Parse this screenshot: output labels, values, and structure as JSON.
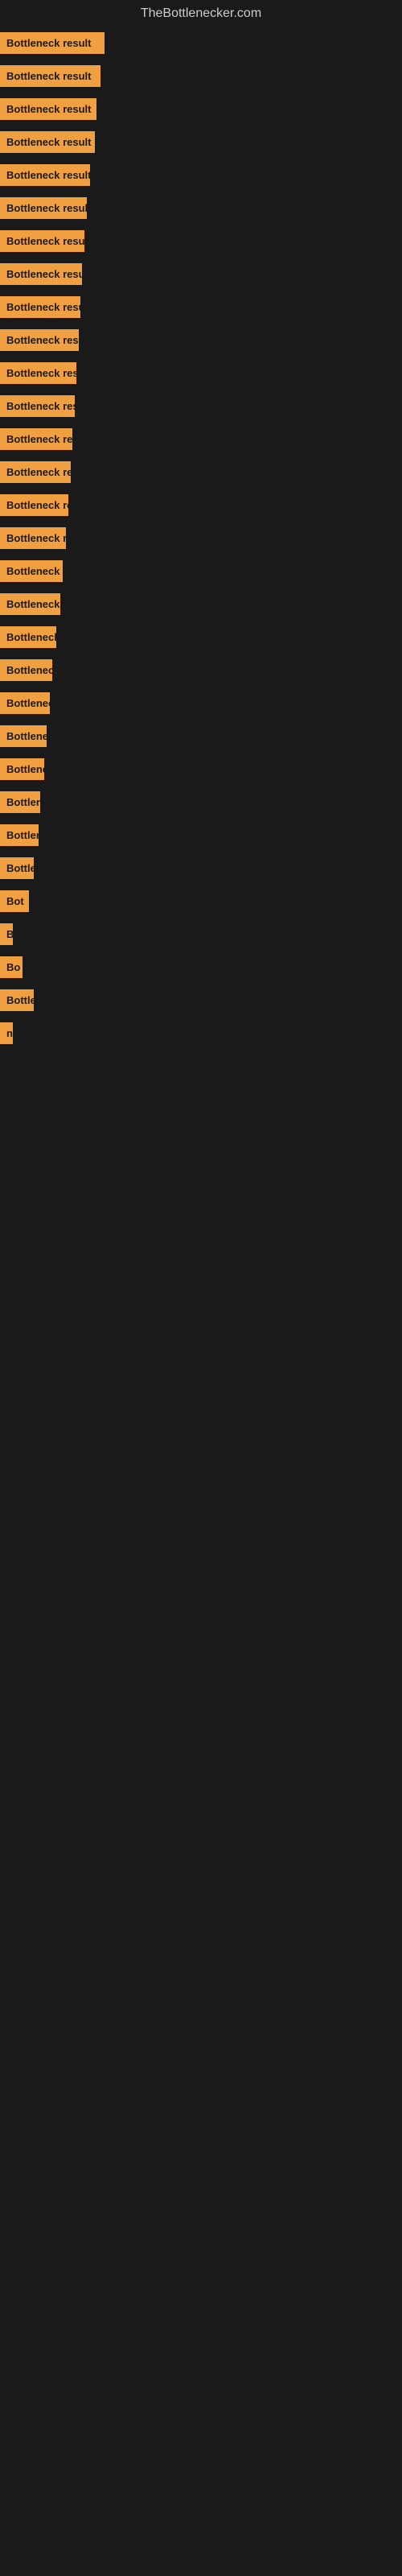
{
  "site": {
    "title": "TheBottlenecker.com"
  },
  "bars": [
    {
      "label": "Bottleneck result",
      "width": 130
    },
    {
      "label": "Bottleneck result",
      "width": 125
    },
    {
      "label": "Bottleneck result",
      "width": 120
    },
    {
      "label": "Bottleneck result",
      "width": 118
    },
    {
      "label": "Bottleneck result",
      "width": 112
    },
    {
      "label": "Bottleneck result",
      "width": 108
    },
    {
      "label": "Bottleneck result",
      "width": 105
    },
    {
      "label": "Bottleneck result",
      "width": 102
    },
    {
      "label": "Bottleneck result",
      "width": 100
    },
    {
      "label": "Bottleneck result",
      "width": 98
    },
    {
      "label": "Bottleneck result",
      "width": 95
    },
    {
      "label": "Bottleneck result",
      "width": 93
    },
    {
      "label": "Bottleneck result",
      "width": 90
    },
    {
      "label": "Bottleneck result",
      "width": 88
    },
    {
      "label": "Bottleneck result",
      "width": 85
    },
    {
      "label": "Bottleneck result",
      "width": 82
    },
    {
      "label": "Bottleneck res",
      "width": 78
    },
    {
      "label": "Bottleneck result",
      "width": 75
    },
    {
      "label": "Bottleneck re",
      "width": 70
    },
    {
      "label": "Bottleneck",
      "width": 65
    },
    {
      "label": "Bottleneck re",
      "width": 62
    },
    {
      "label": "Bottleneck r",
      "width": 58
    },
    {
      "label": "Bottleneck resu",
      "width": 55
    },
    {
      "label": "Bottlenec",
      "width": 50
    },
    {
      "label": "Bottleneck r",
      "width": 48
    },
    {
      "label": "Bottle",
      "width": 42
    },
    {
      "label": "Bot",
      "width": 36
    },
    {
      "label": "B",
      "width": 16
    },
    {
      "label": "Bo",
      "width": 28
    },
    {
      "label": "Bottle",
      "width": 42
    },
    {
      "label": "n",
      "width": 10
    }
  ]
}
